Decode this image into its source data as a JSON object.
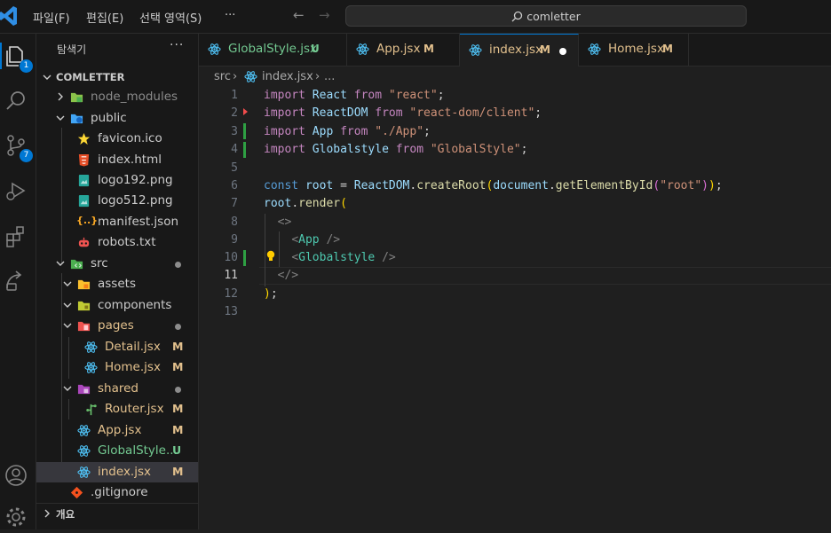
{
  "menu": {
    "file": "파일(F)",
    "edit": "편집(E)",
    "selection": "선택 영역(S)",
    "more": "···"
  },
  "search": {
    "text": "comletter"
  },
  "activity_badges": {
    "explorer": "1",
    "scm": "7"
  },
  "explorer": {
    "title": "탐색기",
    "more": "···",
    "root": "COMLETTER",
    "files": [
      {
        "label": "node_modules",
        "status": ""
      },
      {
        "label": "public",
        "status": ""
      },
      {
        "label": "favicon.ico",
        "status": ""
      },
      {
        "label": "index.html",
        "status": ""
      },
      {
        "label": "logo192.png",
        "status": ""
      },
      {
        "label": "logo512.png",
        "status": ""
      },
      {
        "label": "manifest.json",
        "status": ""
      },
      {
        "label": "robots.txt",
        "status": ""
      },
      {
        "label": "src",
        "status": ""
      },
      {
        "label": "assets",
        "status": ""
      },
      {
        "label": "components",
        "status": ""
      },
      {
        "label": "pages",
        "status": ""
      },
      {
        "label": "Detail.jsx",
        "status": "M"
      },
      {
        "label": "Home.jsx",
        "status": "M"
      },
      {
        "label": "shared",
        "status": ""
      },
      {
        "label": "Router.jsx",
        "status": "M"
      },
      {
        "label": "App.jsx",
        "status": "M"
      },
      {
        "label": "GlobalStyle...",
        "status": "U"
      },
      {
        "label": "index.jsx",
        "status": "M"
      },
      {
        "label": ".gitignore",
        "status": ""
      }
    ],
    "outline": "개요"
  },
  "tabs": [
    {
      "label": "GlobalStyle.jsx",
      "status": "U"
    },
    {
      "label": "App.jsx",
      "status": "M"
    },
    {
      "label": "index.jsx",
      "status": "M"
    },
    {
      "label": "Home.jsx",
      "status": "M"
    }
  ],
  "breadcrumb": {
    "folder": "src",
    "file": "index.jsx",
    "tail": "..."
  },
  "editor": {
    "line_numbers": [
      "1",
      "2",
      "3",
      "4",
      "5",
      "6",
      "7",
      "8",
      "9",
      "10",
      "11",
      "12",
      "13"
    ],
    "current_line": 11,
    "tokens": {
      "import": "import",
      "from": "from",
      "React": "React",
      "ReactDOM": "ReactDOM",
      "App": "App",
      "Globalstyle": "Globalstyle",
      "react_str": "\"react\"",
      "client_str": "\"react-dom/client\"",
      "app_str": "\"./App\"",
      "gs_str": "\"GlobalStyle\"",
      "const": "const",
      "root": "root",
      "createRoot": "createRoot",
      "document": "document",
      "getElementById": "getElementById",
      "root_str": "\"root\"",
      "render": "render"
    }
  },
  "colors": {
    "modified": "#e2c08d",
    "untracked": "#73c991",
    "accent": "#0078d4",
    "added_gutter": "#2ea043"
  }
}
